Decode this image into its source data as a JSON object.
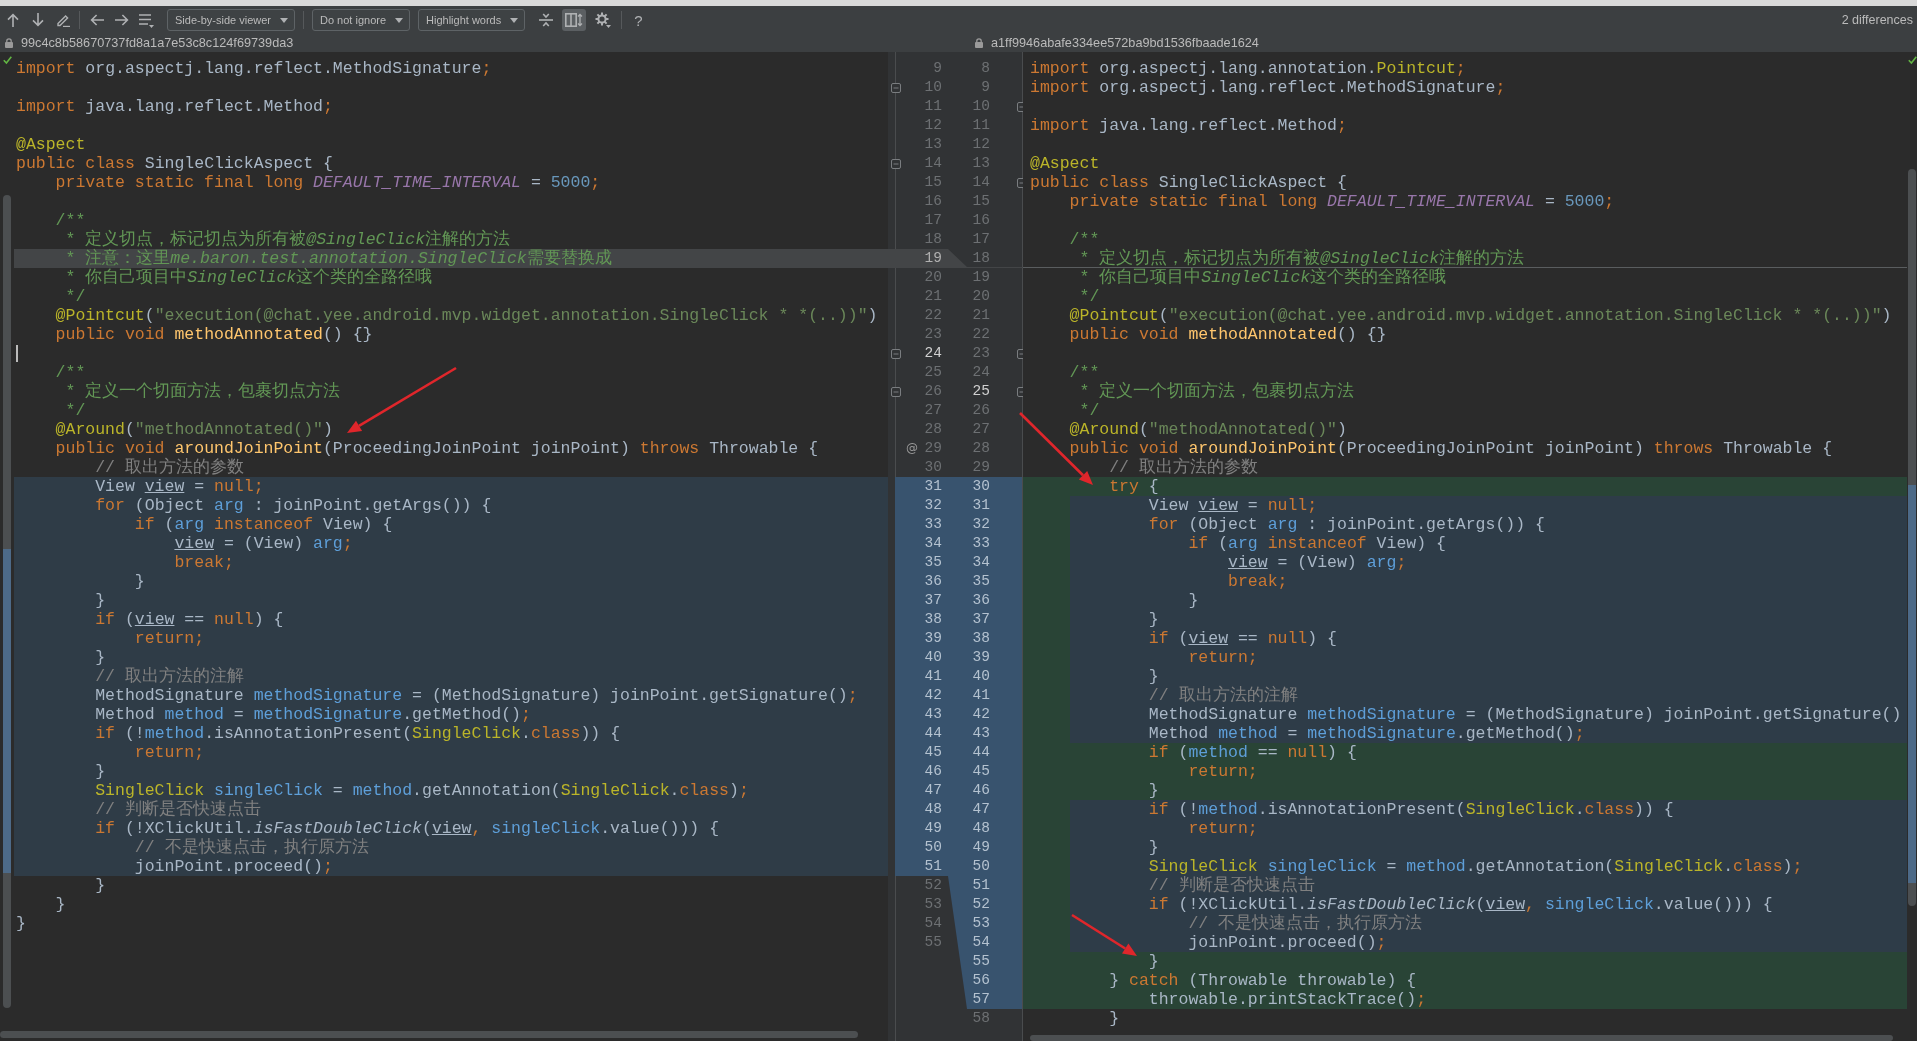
{
  "toolbar": {
    "dropdowns": [
      {
        "label": "Side-by-side viewer"
      },
      {
        "label": "Do not ignore"
      },
      {
        "label": "Highlight words"
      }
    ],
    "toggle": {
      "selected": true
    },
    "help": "?",
    "summary": "2 differences"
  },
  "left_pane": {
    "revision": "99c4c8b58670737fd8a1a7e53c8c124f69739da3",
    "caret": true,
    "rows": [
      {
        "number": "9",
        "kind": "unchanged",
        "fold": false,
        "current": false,
        "tokens": [
          {
            "kind": "keyword",
            "text": "import"
          },
          {
            "kind": "plain",
            "text": " org.aspectj.lang.reflect.MethodSignature"
          },
          {
            "kind": "keyword",
            "text": ";"
          }
        ]
      },
      {
        "number": "10",
        "kind": "unchanged",
        "fold": true,
        "current": false
      },
      {
        "number": "11",
        "kind": "unchanged",
        "fold": false,
        "current": false,
        "tokens": [
          {
            "kind": "keyword",
            "text": "import"
          },
          {
            "kind": "plain",
            "text": " java.lang.reflect.Method"
          },
          {
            "kind": "keyword",
            "text": ";"
          }
        ]
      },
      {
        "number": "12",
        "kind": "unchanged",
        "fold": false,
        "current": false
      },
      {
        "number": "13",
        "kind": "unchanged",
        "fold": false,
        "current": false,
        "tokens": [
          {
            "kind": "annotation",
            "text": "@Aspect"
          }
        ]
      },
      {
        "number": "14",
        "kind": "unchanged",
        "fold": true,
        "current": false,
        "tokens": [
          {
            "kind": "keyword",
            "text": "public class"
          },
          {
            "kind": "plain",
            "text": " SingleClickAspect {"
          }
        ]
      },
      {
        "number": "15",
        "kind": "unchanged",
        "fold": false,
        "current": false,
        "tokens": [
          {
            "kind": "keyword",
            "text": "    private static final long "
          },
          {
            "kind": "constant",
            "text": "DEFAULT_TIME_INTERVAL"
          },
          {
            "kind": "plain",
            "text": " = "
          },
          {
            "kind": "number",
            "text": "5000"
          },
          {
            "kind": "keyword",
            "text": ";"
          }
        ]
      },
      {
        "number": "16",
        "kind": "unchanged",
        "fold": false,
        "current": false
      },
      {
        "number": "17",
        "kind": "unchanged",
        "fold": false,
        "current": false,
        "tokens": [
          {
            "kind": "doc",
            "text": "    /**"
          }
        ]
      },
      {
        "number": "18",
        "kind": "unchanged",
        "fold": false,
        "current": false,
        "tokens": [
          {
            "kind": "doc",
            "text": "     * 定义切点，标记切点为所有被"
          },
          {
            "kind": "docref",
            "text": "@SingleClick"
          },
          {
            "kind": "doc",
            "text": "注解的方法"
          }
        ]
      },
      {
        "number": "19",
        "kind": "deleted",
        "fold": false,
        "current": false,
        "tokens": [
          {
            "kind": "doc",
            "text": "     * 注意：这里"
          },
          {
            "kind": "docref",
            "text": "me.baron.test.annotation.SingleClick"
          },
          {
            "kind": "doc",
            "text": "需要替换成"
          }
        ]
      },
      {
        "number": "20",
        "kind": "unchanged",
        "fold": false,
        "current": false,
        "tokens": [
          {
            "kind": "doc",
            "text": "     * 你自己项目中"
          },
          {
            "kind": "docref",
            "text": "SingleClick"
          },
          {
            "kind": "doc",
            "text": "这个类的全路径哦"
          }
        ]
      },
      {
        "number": "21",
        "kind": "unchanged",
        "fold": false,
        "current": false,
        "tokens": [
          {
            "kind": "doc",
            "text": "     */"
          }
        ]
      },
      {
        "number": "22",
        "kind": "unchanged",
        "fold": false,
        "current": false,
        "tokens": [
          {
            "kind": "annotation",
            "text": "    @Pointcut"
          },
          {
            "kind": "plain",
            "text": "("
          },
          {
            "kind": "string",
            "text": "\"execution(@chat.yee.android.mvp.widget.annotation.SingleClick * *(..))\""
          },
          {
            "kind": "plain",
            "text": ")"
          }
        ]
      },
      {
        "number": "23",
        "kind": "unchanged",
        "fold": false,
        "current": false,
        "tokens": [
          {
            "kind": "keyword",
            "text": "    public void "
          },
          {
            "kind": "declaration",
            "text": "methodAnnotated"
          },
          {
            "kind": "plain",
            "text": "() {}"
          }
        ]
      },
      {
        "number": "24",
        "kind": "unchanged",
        "fold": true,
        "current": true
      },
      {
        "number": "25",
        "kind": "unchanged",
        "fold": false,
        "current": false,
        "tokens": [
          {
            "kind": "doc",
            "text": "    /**"
          }
        ]
      },
      {
        "number": "26",
        "kind": "unchanged",
        "fold": true,
        "current": false,
        "tokens": [
          {
            "kind": "doc",
            "text": "     * 定义一个切面方法，包裹切点方法"
          }
        ]
      },
      {
        "number": "27",
        "kind": "unchanged",
        "fold": false,
        "current": false,
        "tokens": [
          {
            "kind": "doc",
            "text": "     */"
          }
        ]
      },
      {
        "number": "28",
        "kind": "unchanged",
        "fold": false,
        "current": false,
        "tokens": [
          {
            "kind": "annotation",
            "text": "    @Around"
          },
          {
            "kind": "plain",
            "text": "("
          },
          {
            "kind": "string",
            "text": "\"methodAnnotated()\""
          },
          {
            "kind": "plain",
            "text": ")"
          }
        ]
      },
      {
        "number": "29",
        "kind": "unchanged",
        "fold": false,
        "current": false,
        "marker": "@",
        "tokens": [
          {
            "kind": "keyword",
            "text": "    public void "
          },
          {
            "kind": "declaration",
            "text": "aroundJoinPoint"
          },
          {
            "kind": "plain",
            "text": "(ProceedingJoinPoint joinPoint) "
          },
          {
            "kind": "keyword",
            "text": "throws"
          },
          {
            "kind": "plain",
            "text": " Throwable {"
          }
        ]
      },
      {
        "number": "30",
        "kind": "unchanged",
        "fold": false,
        "current": false,
        "tokens": [
          {
            "kind": "comment",
            "text": "        // 取出方法的参数"
          }
        ]
      },
      {
        "number": "31",
        "kind": "modified",
        "fold": false,
        "current": false,
        "tokens": [
          {
            "kind": "plain",
            "text": "        View "
          },
          {
            "kind": "reassigned",
            "text": "view"
          },
          {
            "kind": "plain",
            "text": " = "
          },
          {
            "kind": "keyword",
            "text": "null;"
          }
        ]
      },
      {
        "number": "32",
        "kind": "modified",
        "fold": false,
        "current": false,
        "tokens": [
          {
            "kind": "keyword",
            "text": "        for"
          },
          {
            "kind": "plain",
            "text": " (Object "
          },
          {
            "kind": "variable",
            "text": "arg"
          },
          {
            "kind": "plain",
            "text": " : joinPoint.getArgs()) {"
          }
        ]
      },
      {
        "number": "33",
        "kind": "modified",
        "fold": false,
        "current": false,
        "tokens": [
          {
            "kind": "keyword",
            "text": "            if"
          },
          {
            "kind": "plain",
            "text": " ("
          },
          {
            "kind": "variable",
            "text": "arg"
          },
          {
            "kind": "keyword",
            "text": " instanceof"
          },
          {
            "kind": "plain",
            "text": " View) {"
          }
        ]
      },
      {
        "number": "34",
        "kind": "modified",
        "fold": false,
        "current": false,
        "tokens": [
          {
            "kind": "reassigned",
            "text": "                view"
          },
          {
            "kind": "plain",
            "text": " = (View) "
          },
          {
            "kind": "variable",
            "text": "arg"
          },
          {
            "kind": "keyword",
            "text": ";"
          }
        ]
      },
      {
        "number": "35",
        "kind": "modified",
        "fold": false,
        "current": false,
        "tokens": [
          {
            "kind": "keyword",
            "text": "                break;"
          }
        ]
      },
      {
        "number": "36",
        "kind": "modified",
        "fold": false,
        "current": false,
        "tokens": [
          {
            "kind": "plain",
            "text": "            }"
          }
        ]
      },
      {
        "number": "37",
        "kind": "modified",
        "fold": false,
        "current": false,
        "tokens": [
          {
            "kind": "plain",
            "text": "        }"
          }
        ]
      },
      {
        "number": "38",
        "kind": "modified",
        "fold": false,
        "current": false,
        "tokens": [
          {
            "kind": "keyword",
            "text": "        if"
          },
          {
            "kind": "plain",
            "text": " ("
          },
          {
            "kind": "reassigned",
            "text": "view"
          },
          {
            "kind": "plain",
            "text": " == "
          },
          {
            "kind": "keyword",
            "text": "null"
          },
          {
            "kind": "plain",
            "text": ") {"
          }
        ]
      },
      {
        "number": "39",
        "kind": "modified",
        "fold": false,
        "current": false,
        "tokens": [
          {
            "kind": "keyword",
            "text": "            return;"
          }
        ]
      },
      {
        "number": "40",
        "kind": "modified",
        "fold": false,
        "current": false,
        "tokens": [
          {
            "kind": "plain",
            "text": "        }"
          }
        ]
      },
      {
        "number": "41",
        "kind": "modified",
        "fold": false,
        "current": false,
        "tokens": [
          {
            "kind": "comment",
            "text": "        // 取出方法的注解"
          }
        ]
      },
      {
        "number": "42",
        "kind": "modified",
        "fold": false,
        "current": false,
        "tokens": [
          {
            "kind": "plain",
            "text": "        MethodSignature "
          },
          {
            "kind": "variable",
            "text": "methodSignature"
          },
          {
            "kind": "plain",
            "text": " = (MethodSignature) joinPoint.getSignature()"
          },
          {
            "kind": "keyword",
            "text": ";"
          }
        ]
      },
      {
        "number": "43",
        "kind": "modified",
        "fold": false,
        "current": false,
        "tokens": [
          {
            "kind": "plain",
            "text": "        Method "
          },
          {
            "kind": "variable",
            "text": "method"
          },
          {
            "kind": "plain",
            "text": " = "
          },
          {
            "kind": "variable",
            "text": "methodSignature"
          },
          {
            "kind": "plain",
            "text": ".getMethod()"
          },
          {
            "kind": "keyword",
            "text": ";"
          }
        ]
      },
      {
        "number": "44",
        "kind": "modified",
        "fold": false,
        "current": false,
        "tokens": [
          {
            "kind": "keyword",
            "text": "        if"
          },
          {
            "kind": "plain",
            "text": " (!"
          },
          {
            "kind": "variable",
            "text": "method"
          },
          {
            "kind": "plain",
            "text": ".isAnnotationPresent("
          },
          {
            "kind": "annotation",
            "text": "SingleClick"
          },
          {
            "kind": "plain",
            "text": "."
          },
          {
            "kind": "keyword",
            "text": "class"
          },
          {
            "kind": "plain",
            "text": ")) {"
          }
        ]
      },
      {
        "number": "45",
        "kind": "modified",
        "fold": false,
        "current": false,
        "tokens": [
          {
            "kind": "keyword",
            "text": "            return;"
          }
        ]
      },
      {
        "number": "46",
        "kind": "modified",
        "fold": false,
        "current": false,
        "tokens": [
          {
            "kind": "plain",
            "text": "        }"
          }
        ]
      },
      {
        "number": "47",
        "kind": "modified",
        "fold": false,
        "current": false,
        "tokens": [
          {
            "kind": "annotation",
            "text": "        SingleClick "
          },
          {
            "kind": "variable",
            "text": "singleClick"
          },
          {
            "kind": "plain",
            "text": " = "
          },
          {
            "kind": "variable",
            "text": "method"
          },
          {
            "kind": "plain",
            "text": ".getAnnotation("
          },
          {
            "kind": "annotation",
            "text": "SingleClick"
          },
          {
            "kind": "plain",
            "text": "."
          },
          {
            "kind": "keyword",
            "text": "class"
          },
          {
            "kind": "plain",
            "text": ")"
          },
          {
            "kind": "keyword",
            "text": ";"
          }
        ]
      },
      {
        "number": "48",
        "kind": "modified",
        "fold": false,
        "current": false,
        "tokens": [
          {
            "kind": "comment",
            "text": "        // 判断是否快速点击"
          }
        ]
      },
      {
        "number": "49",
        "kind": "modified",
        "fold": false,
        "current": false,
        "tokens": [
          {
            "kind": "keyword",
            "text": "        if"
          },
          {
            "kind": "plain",
            "text": " (!XClickUtil."
          },
          {
            "kind": "static",
            "text": "isFastDoubleClick"
          },
          {
            "kind": "plain",
            "text": "("
          },
          {
            "kind": "reassigned",
            "text": "view"
          },
          {
            "kind": "keyword",
            "text": ", "
          },
          {
            "kind": "variable",
            "text": "singleClick"
          },
          {
            "kind": "plain",
            "text": ".value())) {"
          }
        ]
      },
      {
        "number": "50",
        "kind": "modified",
        "fold": false,
        "current": false,
        "tokens": [
          {
            "kind": "comment",
            "text": "            // 不是快速点击，执行原方法"
          }
        ]
      },
      {
        "number": "51",
        "kind": "modified",
        "fold": false,
        "current": false,
        "tokens": [
          {
            "kind": "plain",
            "text": "            joinPoint.proceed()"
          },
          {
            "kind": "keyword",
            "text": ";"
          }
        ]
      },
      {
        "number": "52",
        "kind": "unchanged",
        "fold": false,
        "current": false,
        "tokens": [
          {
            "kind": "plain",
            "text": "        }"
          }
        ]
      },
      {
        "number": "53",
        "kind": "unchanged",
        "fold": false,
        "current": false,
        "tokens": [
          {
            "kind": "plain",
            "text": "    }"
          }
        ]
      },
      {
        "number": "54",
        "kind": "unchanged",
        "fold": false,
        "current": false,
        "tokens": [
          {
            "kind": "plain",
            "text": "}"
          }
        ]
      },
      {
        "number": "55",
        "kind": "unchanged",
        "fold": false,
        "current": false
      }
    ]
  },
  "right_pane": {
    "revision": "a1ff9946abafe334ee572ba9bd1536fbaade1624",
    "caret": false,
    "rows": [
      {
        "number": "8",
        "kind": "unchanged",
        "fold": false,
        "current": false,
        "tokens": [
          {
            "kind": "keyword",
            "text": "import"
          },
          {
            "kind": "plain",
            "text": " org.aspectj.lang.annotation."
          },
          {
            "kind": "annotation",
            "text": "Pointcut"
          },
          {
            "kind": "keyword",
            "text": ";"
          }
        ]
      },
      {
        "number": "9",
        "kind": "unchanged",
        "fold": false,
        "current": false,
        "tokens": [
          {
            "kind": "keyword",
            "text": "import"
          },
          {
            "kind": "plain",
            "text": " org.aspectj.lang.reflect.MethodSignature"
          },
          {
            "kind": "keyword",
            "text": ";"
          }
        ]
      },
      {
        "number": "10",
        "kind": "unchanged",
        "fold": true,
        "current": false
      },
      {
        "number": "11",
        "kind": "unchanged",
        "fold": false,
        "current": false,
        "tokens": [
          {
            "kind": "keyword",
            "text": "import"
          },
          {
            "kind": "plain",
            "text": " java.lang.reflect.Method"
          },
          {
            "kind": "keyword",
            "text": ";"
          }
        ]
      },
      {
        "number": "12",
        "kind": "unchanged",
        "fold": false,
        "current": false
      },
      {
        "number": "13",
        "kind": "unchanged",
        "fold": false,
        "current": false,
        "tokens": [
          {
            "kind": "annotation",
            "text": "@Aspect"
          }
        ]
      },
      {
        "number": "14",
        "kind": "unchanged",
        "fold": true,
        "current": false,
        "tokens": [
          {
            "kind": "keyword",
            "text": "public class"
          },
          {
            "kind": "plain",
            "text": " SingleClickAspect {"
          }
        ]
      },
      {
        "number": "15",
        "kind": "unchanged",
        "fold": false,
        "current": false,
        "tokens": [
          {
            "kind": "keyword",
            "text": "    private static final long "
          },
          {
            "kind": "constant",
            "text": "DEFAULT_TIME_INTERVAL"
          },
          {
            "kind": "plain",
            "text": " = "
          },
          {
            "kind": "number",
            "text": "5000"
          },
          {
            "kind": "keyword",
            "text": ";"
          }
        ]
      },
      {
        "number": "16",
        "kind": "unchanged",
        "fold": false,
        "current": false
      },
      {
        "number": "17",
        "kind": "unchanged",
        "fold": false,
        "current": false,
        "tokens": [
          {
            "kind": "doc",
            "text": "    /**"
          }
        ]
      },
      {
        "number": "18",
        "kind": "unchanged",
        "fold": false,
        "current": false,
        "tokens": [
          {
            "kind": "doc",
            "text": "     * 定义切点，标记切点为所有被"
          },
          {
            "kind": "docref",
            "text": "@SingleClick"
          },
          {
            "kind": "doc",
            "text": "注解的方法"
          }
        ]
      },
      {
        "number": "19",
        "kind": "unchanged",
        "fold": false,
        "current": false,
        "tokens": [
          {
            "kind": "doc",
            "text": "     * 你自己项目中"
          },
          {
            "kind": "docref",
            "text": "SingleClick"
          },
          {
            "kind": "doc",
            "text": "这个类的全路径哦"
          }
        ]
      },
      {
        "number": "20",
        "kind": "unchanged",
        "fold": false,
        "current": false,
        "tokens": [
          {
            "kind": "doc",
            "text": "     */"
          }
        ]
      },
      {
        "number": "21",
        "kind": "unchanged",
        "fold": false,
        "current": false,
        "tokens": [
          {
            "kind": "annotation",
            "text": "    @Pointcut"
          },
          {
            "kind": "plain",
            "text": "("
          },
          {
            "kind": "string",
            "text": "\"execution(@chat.yee.android.mvp.widget.annotation.SingleClick * *(..))\""
          },
          {
            "kind": "plain",
            "text": ")"
          }
        ]
      },
      {
        "number": "22",
        "kind": "unchanged",
        "fold": false,
        "current": false,
        "tokens": [
          {
            "kind": "keyword",
            "text": "    public void "
          },
          {
            "kind": "declaration",
            "text": "methodAnnotated"
          },
          {
            "kind": "plain",
            "text": "() {}"
          }
        ]
      },
      {
        "number": "23",
        "kind": "unchanged",
        "fold": true,
        "current": false
      },
      {
        "number": "24",
        "kind": "unchanged",
        "fold": false,
        "current": false,
        "tokens": [
          {
            "kind": "doc",
            "text": "    /**"
          }
        ]
      },
      {
        "number": "25",
        "kind": "unchanged",
        "fold": true,
        "current": true,
        "tokens": [
          {
            "kind": "doc",
            "text": "     * 定义一个切面方法，包裹切点方法"
          }
        ]
      },
      {
        "number": "26",
        "kind": "unchanged",
        "fold": false,
        "current": false,
        "tokens": [
          {
            "kind": "doc",
            "text": "     */"
          }
        ]
      },
      {
        "number": "27",
        "kind": "unchanged",
        "fold": false,
        "current": false,
        "tokens": [
          {
            "kind": "annotation",
            "text": "    @Around"
          },
          {
            "kind": "plain",
            "text": "("
          },
          {
            "kind": "string",
            "text": "\"methodAnnotated()\""
          },
          {
            "kind": "plain",
            "text": ")"
          }
        ]
      },
      {
        "number": "28",
        "kind": "unchanged",
        "fold": false,
        "current": false,
        "tokens": [
          {
            "kind": "keyword",
            "text": "    public void "
          },
          {
            "kind": "declaration",
            "text": "aroundJoinPoint"
          },
          {
            "kind": "plain",
            "text": "(ProceedingJoinPoint joinPoint) "
          },
          {
            "kind": "keyword",
            "text": "throws"
          },
          {
            "kind": "plain",
            "text": " Throwable {"
          }
        ]
      },
      {
        "number": "29",
        "kind": "unchanged",
        "fold": false,
        "current": false,
        "tokens": [
          {
            "kind": "comment",
            "text": "        // 取出方法的参数"
          }
        ]
      },
      {
        "number": "30",
        "kind": "inserted",
        "fold": false,
        "current": false,
        "tokens": [
          {
            "kind": "keyword",
            "text": "        try"
          },
          {
            "kind": "plain",
            "text": " {"
          }
        ]
      },
      {
        "number": "31",
        "kind": "modified",
        "fold": false,
        "current": false,
        "tokens": [
          {
            "kind": "plain",
            "text": "            View "
          },
          {
            "kind": "reassigned",
            "text": "view"
          },
          {
            "kind": "plain",
            "text": " = "
          },
          {
            "kind": "keyword",
            "text": "null;"
          }
        ]
      },
      {
        "number": "32",
        "kind": "modified",
        "fold": false,
        "current": false,
        "tokens": [
          {
            "kind": "keyword",
            "text": "            for"
          },
          {
            "kind": "plain",
            "text": " (Object "
          },
          {
            "kind": "variable",
            "text": "arg"
          },
          {
            "kind": "plain",
            "text": " : joinPoint.getArgs()) {"
          }
        ]
      },
      {
        "number": "33",
        "kind": "modified",
        "fold": false,
        "current": false,
        "tokens": [
          {
            "kind": "keyword",
            "text": "                if"
          },
          {
            "kind": "plain",
            "text": " ("
          },
          {
            "kind": "variable",
            "text": "arg"
          },
          {
            "kind": "keyword",
            "text": " instanceof"
          },
          {
            "kind": "plain",
            "text": " View) {"
          }
        ]
      },
      {
        "number": "34",
        "kind": "modified",
        "fold": false,
        "current": false,
        "tokens": [
          {
            "kind": "reassigned",
            "text": "                    view"
          },
          {
            "kind": "plain",
            "text": " = (View) "
          },
          {
            "kind": "variable",
            "text": "arg"
          },
          {
            "kind": "keyword",
            "text": ";"
          }
        ]
      },
      {
        "number": "35",
        "kind": "modified",
        "fold": false,
        "current": false,
        "tokens": [
          {
            "kind": "keyword",
            "text": "                    break;"
          }
        ]
      },
      {
        "number": "36",
        "kind": "modified",
        "fold": false,
        "current": false,
        "tokens": [
          {
            "kind": "plain",
            "text": "                }"
          }
        ]
      },
      {
        "number": "37",
        "kind": "modified",
        "fold": false,
        "current": false,
        "tokens": [
          {
            "kind": "plain",
            "text": "            }"
          }
        ]
      },
      {
        "number": "38",
        "kind": "modified",
        "fold": false,
        "current": false,
        "tokens": [
          {
            "kind": "keyword",
            "text": "            if"
          },
          {
            "kind": "plain",
            "text": " ("
          },
          {
            "kind": "reassigned",
            "text": "view"
          },
          {
            "kind": "plain",
            "text": " == "
          },
          {
            "kind": "keyword",
            "text": "null"
          },
          {
            "kind": "plain",
            "text": ") {"
          }
        ]
      },
      {
        "number": "39",
        "kind": "modified",
        "fold": false,
        "current": false,
        "tokens": [
          {
            "kind": "keyword",
            "text": "                return;"
          }
        ]
      },
      {
        "number": "40",
        "kind": "modified",
        "fold": false,
        "current": false,
        "tokens": [
          {
            "kind": "plain",
            "text": "            }"
          }
        ]
      },
      {
        "number": "41",
        "kind": "modified",
        "fold": false,
        "current": false,
        "tokens": [
          {
            "kind": "comment",
            "text": "            // 取出方法的注解"
          }
        ]
      },
      {
        "number": "42",
        "kind": "modified",
        "fold": false,
        "current": false,
        "tokens": [
          {
            "kind": "plain",
            "text": "            MethodSignature "
          },
          {
            "kind": "variable",
            "text": "methodSignature"
          },
          {
            "kind": "plain",
            "text": " = (MethodSignature) joinPoint.getSignature()"
          }
        ]
      },
      {
        "number": "43",
        "kind": "modified",
        "fold": false,
        "current": false,
        "tokens": [
          {
            "kind": "plain",
            "text": "            Method "
          },
          {
            "kind": "variable",
            "text": "method"
          },
          {
            "kind": "plain",
            "text": " = "
          },
          {
            "kind": "variable",
            "text": "methodSignature"
          },
          {
            "kind": "plain",
            "text": ".getMethod()"
          },
          {
            "kind": "keyword",
            "text": ";"
          }
        ]
      },
      {
        "number": "44",
        "kind": "inserted",
        "fold": false,
        "current": false,
        "tokens": [
          {
            "kind": "keyword",
            "text": "            if"
          },
          {
            "kind": "plain",
            "text": " ("
          },
          {
            "kind": "variable",
            "text": "method"
          },
          {
            "kind": "plain",
            "text": " == "
          },
          {
            "kind": "keyword",
            "text": "null"
          },
          {
            "kind": "plain",
            "text": ") {"
          }
        ]
      },
      {
        "number": "45",
        "kind": "inserted",
        "fold": false,
        "current": false,
        "tokens": [
          {
            "kind": "keyword",
            "text": "                return;"
          }
        ]
      },
      {
        "number": "46",
        "kind": "inserted",
        "fold": false,
        "current": false,
        "tokens": [
          {
            "kind": "plain",
            "text": "            }"
          }
        ]
      },
      {
        "number": "47",
        "kind": "modified",
        "fold": false,
        "current": false,
        "tokens": [
          {
            "kind": "keyword",
            "text": "            if"
          },
          {
            "kind": "plain",
            "text": " (!"
          },
          {
            "kind": "variable",
            "text": "method"
          },
          {
            "kind": "plain",
            "text": ".isAnnotationPresent("
          },
          {
            "kind": "annotation",
            "text": "SingleClick"
          },
          {
            "kind": "plain",
            "text": "."
          },
          {
            "kind": "keyword",
            "text": "class"
          },
          {
            "kind": "plain",
            "text": ")) {"
          }
        ]
      },
      {
        "number": "48",
        "kind": "modified",
        "fold": false,
        "current": false,
        "tokens": [
          {
            "kind": "keyword",
            "text": "                return;"
          }
        ]
      },
      {
        "number": "49",
        "kind": "modified",
        "fold": false,
        "current": false,
        "tokens": [
          {
            "kind": "plain",
            "text": "            }"
          }
        ]
      },
      {
        "number": "50",
        "kind": "modified",
        "fold": false,
        "current": false,
        "tokens": [
          {
            "kind": "annotation",
            "text": "            SingleClick "
          },
          {
            "kind": "variable",
            "text": "singleClick"
          },
          {
            "kind": "plain",
            "text": " = "
          },
          {
            "kind": "variable",
            "text": "method"
          },
          {
            "kind": "plain",
            "text": ".getAnnotation("
          },
          {
            "kind": "annotation",
            "text": "SingleClick"
          },
          {
            "kind": "plain",
            "text": "."
          },
          {
            "kind": "keyword",
            "text": "class"
          },
          {
            "kind": "plain",
            "text": ")"
          },
          {
            "kind": "keyword",
            "text": ";"
          }
        ]
      },
      {
        "number": "51",
        "kind": "modified",
        "fold": false,
        "current": false,
        "tokens": [
          {
            "kind": "comment",
            "text": "            // 判断是否快速点击"
          }
        ]
      },
      {
        "number": "52",
        "kind": "modified",
        "fold": false,
        "current": false,
        "tokens": [
          {
            "kind": "keyword",
            "text": "            if"
          },
          {
            "kind": "plain",
            "text": " (!XClickUtil."
          },
          {
            "kind": "static",
            "text": "isFastDoubleClick"
          },
          {
            "kind": "plain",
            "text": "("
          },
          {
            "kind": "reassigned",
            "text": "view"
          },
          {
            "kind": "keyword",
            "text": ", "
          },
          {
            "kind": "variable",
            "text": "singleClick"
          },
          {
            "kind": "plain",
            "text": ".value())) {"
          }
        ]
      },
      {
        "number": "53",
        "kind": "modified",
        "fold": false,
        "current": false,
        "tokens": [
          {
            "kind": "comment",
            "text": "                // 不是快速点击，执行原方法"
          }
        ]
      },
      {
        "number": "54",
        "kind": "modified",
        "fold": false,
        "current": false,
        "tokens": [
          {
            "kind": "plain",
            "text": "                joinPoint.proceed()"
          },
          {
            "kind": "keyword",
            "text": ";"
          }
        ]
      },
      {
        "number": "55",
        "kind": "inserted",
        "fold": false,
        "current": false,
        "tokens": [
          {
            "kind": "plain",
            "text": "            }"
          }
        ]
      },
      {
        "number": "56",
        "kind": "inserted",
        "fold": false,
        "current": false,
        "tokens": [
          {
            "kind": "plain",
            "text": "        } "
          },
          {
            "kind": "keyword",
            "text": "catch"
          },
          {
            "kind": "plain",
            "text": " (Throwable throwable) {"
          }
        ]
      },
      {
        "number": "57",
        "kind": "inserted",
        "fold": false,
        "current": false,
        "tokens": [
          {
            "kind": "plain",
            "text": "            throwable.printStackTrace()"
          },
          {
            "kind": "keyword",
            "text": ";"
          }
        ]
      },
      {
        "number": "58",
        "kind": "unchanged",
        "fold": false,
        "current": false,
        "tokens": [
          {
            "kind": "plain",
            "text": "        }"
          }
        ]
      }
    ]
  },
  "annotations": [
    {
      "kind": "arrow"
    },
    {
      "kind": "arrow"
    },
    {
      "kind": "arrow"
    }
  ]
}
